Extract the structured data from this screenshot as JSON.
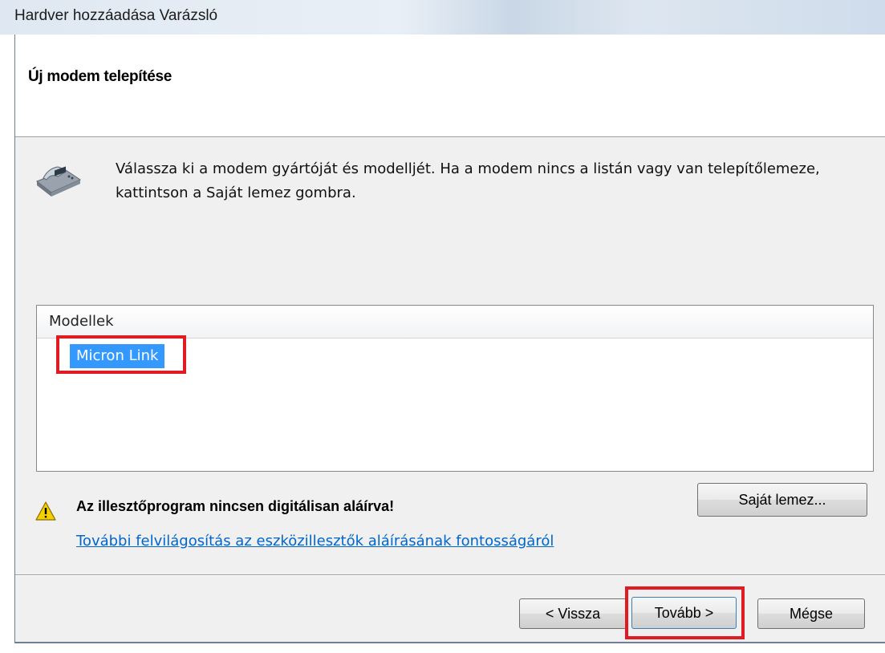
{
  "window": {
    "title": "Hardver hozzáadása Varázsló"
  },
  "header": {
    "heading": "Új modem telepítése"
  },
  "instruction": "Válassza ki a modem gyártóját és modelljét. Ha a modem nincs a listán vagy van telepítőlemeze, kattintson a Saját lemez gombra.",
  "models_list": {
    "column_header": "Modellek",
    "items": [
      "Micron Link"
    ],
    "selected": "Micron Link"
  },
  "warning": {
    "text": "Az illesztőprogram nincsen digitálisan aláírva!",
    "link": "További felvilágosítás az eszközillesztők aláírásának fontosságáról"
  },
  "buttons": {
    "have_disk": "Saját lemez...",
    "back": "< Vissza",
    "next": "Tovább >",
    "cancel": "Mégse"
  },
  "colors": {
    "selection": "#3399ff",
    "highlight_box": "#e11b22",
    "link": "#0066cc",
    "dialog_bg": "#f0f0f0"
  },
  "icons": [
    "modem-icon",
    "warning-icon"
  ]
}
